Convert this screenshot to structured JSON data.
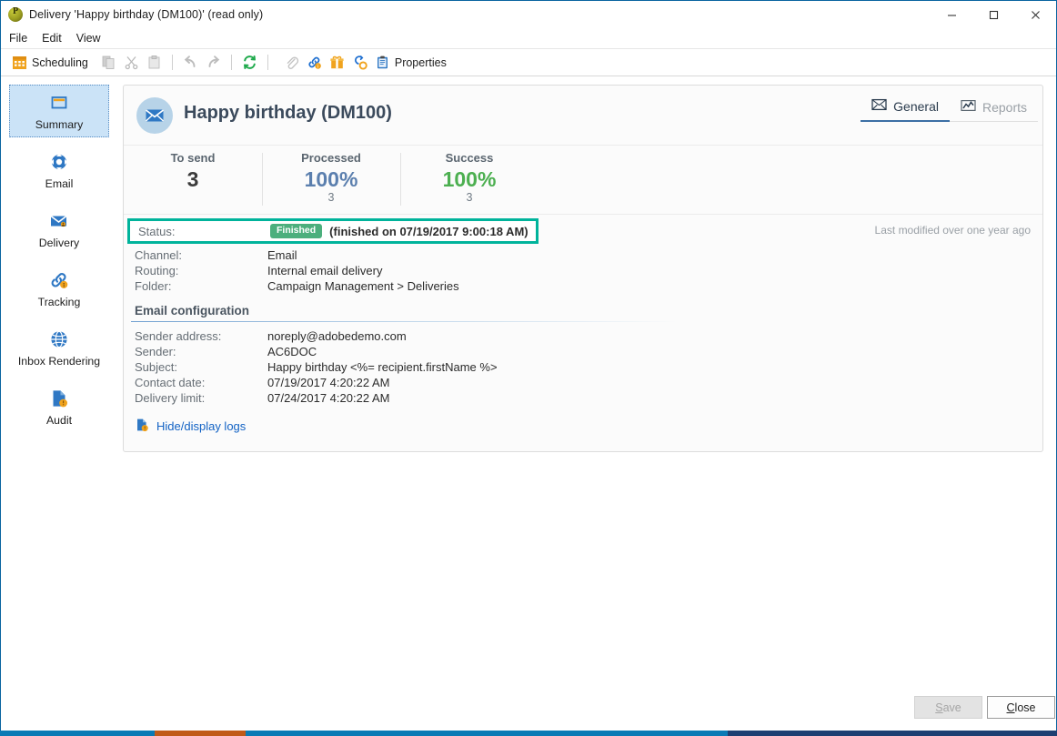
{
  "window": {
    "title": "Delivery 'Happy birthday (DM100)' (read only)",
    "app_icon": "power-icon",
    "minimize": "minimize-icon",
    "maximize": "maximize-icon",
    "close": "close-icon"
  },
  "menubar": {
    "items": [
      {
        "label": "File"
      },
      {
        "label": "Edit"
      },
      {
        "label": "View"
      }
    ]
  },
  "toolbar": {
    "scheduling_label": "Scheduling",
    "scheduling_icon": "calendar-icon",
    "properties_label": "Properties",
    "properties_icon": "clipboard-icon",
    "items": [
      {
        "name": "copy",
        "icon": "copy-icon",
        "enabled": false
      },
      {
        "name": "cut",
        "icon": "scissors-icon",
        "enabled": false
      },
      {
        "name": "paste",
        "icon": "paste-icon",
        "enabled": false
      },
      {
        "name": "undo",
        "icon": "undo-arrow-icon",
        "enabled": false
      },
      {
        "name": "redo",
        "icon": "redo-arrow-icon",
        "enabled": false
      },
      {
        "name": "refresh",
        "icon": "refresh-icon",
        "enabled": true
      },
      {
        "name": "attachment",
        "icon": "paperclip-icon",
        "enabled": false
      },
      {
        "name": "tracking-links",
        "icon": "chain-link-icon",
        "enabled": true
      },
      {
        "name": "offers",
        "icon": "gift-icon",
        "enabled": true
      },
      {
        "name": "workflow",
        "icon": "node-link-icon",
        "enabled": true
      }
    ]
  },
  "sidebar": {
    "items": [
      {
        "label": "Summary",
        "icon": "window-summary-icon",
        "active": true
      },
      {
        "label": "Email",
        "icon": "email-node-icon",
        "active": false
      },
      {
        "label": "Delivery",
        "icon": "delivery-envelope-icon",
        "active": false
      },
      {
        "label": "Tracking",
        "icon": "tracking-link-icon",
        "active": false
      },
      {
        "label": "Inbox Rendering",
        "icon": "globe-icon",
        "active": false
      },
      {
        "label": "Audit",
        "icon": "audit-doc-icon",
        "active": false
      }
    ]
  },
  "card": {
    "doc_title": "Happy birthday (DM100)",
    "title_icon": "envelope-icon",
    "tabs": [
      {
        "label": "General",
        "icon": "envelope-outline-icon",
        "active": true
      },
      {
        "label": "Reports",
        "icon": "chart-line-icon",
        "active": false
      }
    ],
    "kpis": [
      {
        "label": "To send",
        "value": "3",
        "sub": "",
        "color": "#3b3b3b"
      },
      {
        "label": "Processed",
        "value": "100%",
        "sub": "3",
        "color": "#5b7fae"
      },
      {
        "label": "Success",
        "value": "100%",
        "sub": "3",
        "color": "#4caf50"
      }
    ],
    "status": {
      "label": "Status:",
      "badge": "Finished",
      "detail": "(finished on 07/19/2017 9:00:18 AM)",
      "highlight_color": "#00b39b",
      "badge_color": "#4caf7d"
    },
    "last_modified": "Last modified over one year ago",
    "details": [
      {
        "label": "Channel:",
        "value": "Email"
      },
      {
        "label": "Routing:",
        "value": "Internal email delivery"
      },
      {
        "label": "Folder:",
        "value": "Campaign Management > Deliveries"
      }
    ],
    "section_title": "Email configuration",
    "config": [
      {
        "label": "Sender address:",
        "value": "noreply@adobedemo.com"
      },
      {
        "label": "Sender:",
        "value": "AC6DOC"
      },
      {
        "label": "Subject:",
        "value": "Happy birthday <%= recipient.firstName %>"
      },
      {
        "label": "Contact date:",
        "value": "07/19/2017 4:20:22 AM"
      },
      {
        "label": "Delivery limit:",
        "value": "07/24/2017 4:20:22 AM"
      }
    ],
    "logs_link": {
      "label": "Hide/display logs",
      "icon": "log-doc-icon"
    }
  },
  "footer": {
    "save": {
      "label": "Save",
      "accel": "S",
      "enabled": false
    },
    "close": {
      "label": "Close",
      "accel": "C",
      "enabled": true
    }
  }
}
